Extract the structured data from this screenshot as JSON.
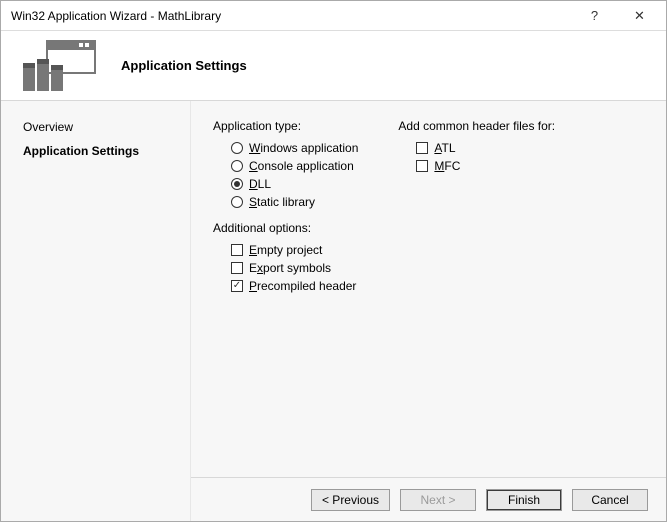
{
  "titlebar": {
    "title": "Win32 Application Wizard - MathLibrary",
    "help": "?",
    "close": "✕"
  },
  "header": {
    "title": "Application Settings"
  },
  "sidebar": {
    "items": [
      {
        "label": "Overview",
        "active": false
      },
      {
        "label": "Application Settings",
        "active": true
      }
    ]
  },
  "content": {
    "app_type_label": "Application type:",
    "app_type": [
      {
        "label": "Windows application",
        "underline": "W",
        "checked": false
      },
      {
        "label": "Console application",
        "underline": "C",
        "checked": false
      },
      {
        "label": "DLL",
        "underline": "D",
        "checked": true
      },
      {
        "label": "Static library",
        "underline": "S",
        "checked": false
      }
    ],
    "additional_label": "Additional options:",
    "additional": [
      {
        "label": "Empty project",
        "underline": "E",
        "checked": false
      },
      {
        "label": "Export symbols",
        "underline": "x",
        "checked": false
      },
      {
        "label": "Precompiled header",
        "underline": "P",
        "checked": true
      }
    ],
    "headers_label": "Add common header files for:",
    "headers": [
      {
        "label": "ATL",
        "underline": "A",
        "checked": false
      },
      {
        "label": "MFC",
        "underline": "M",
        "checked": false
      }
    ]
  },
  "footer": {
    "previous": "< Previous",
    "next": "Next >",
    "finish": "Finish",
    "cancel": "Cancel"
  }
}
